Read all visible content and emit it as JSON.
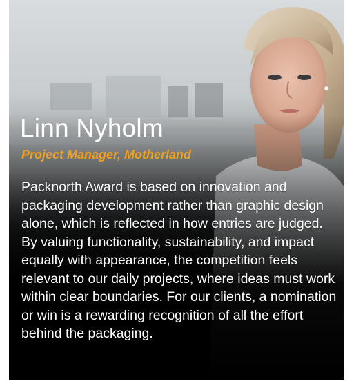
{
  "testimonial": {
    "name": "Linn Nyholm",
    "role": "Project Manager, Motherland",
    "quote": "Packnorth Award is based on innovation and packaging development rather than graphic design alone, which is reflected in how entries are judged. By valuing functionality, sustainability, and impact equally with appearance, the competition feels relevant to our daily projects, where ideas must work within clear boundaries. For our clients, a nomination or win is a rewarding recognition of all the effort behind the packaging."
  },
  "colors": {
    "accent": "#f0a020",
    "text": "#ffffff",
    "background": "#000000"
  }
}
